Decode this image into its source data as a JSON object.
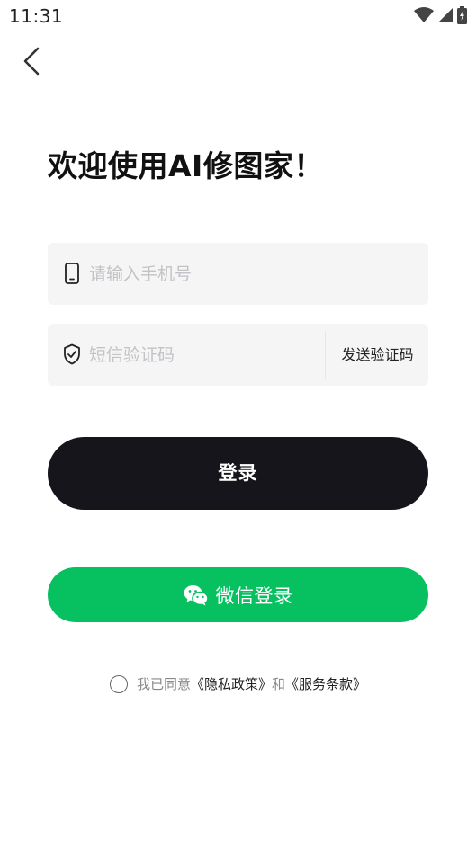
{
  "status_bar": {
    "time": "11:31"
  },
  "page": {
    "title": "欢迎使用AI修图家！"
  },
  "form": {
    "phone": {
      "value": "",
      "placeholder": "请输入手机号"
    },
    "code": {
      "value": "",
      "placeholder": "短信验证码"
    },
    "send_code_label": "发送验证码"
  },
  "buttons": {
    "login": "登录",
    "wechat_login": "微信登录"
  },
  "agreement": {
    "prefix": "我已同意",
    "privacy_link": "《隐私政策》",
    "and": "和",
    "terms_link": "《服务条款》"
  },
  "colors": {
    "primary_dark": "#15151b",
    "wechat_green": "#07c160",
    "field_bg": "#f5f5f6",
    "placeholder": "#c3c3c7"
  },
  "icons": [
    "back-arrow-icon",
    "wifi-icon",
    "signal-icon",
    "battery-icon",
    "phone-icon",
    "shield-check-icon",
    "wechat-icon"
  ]
}
